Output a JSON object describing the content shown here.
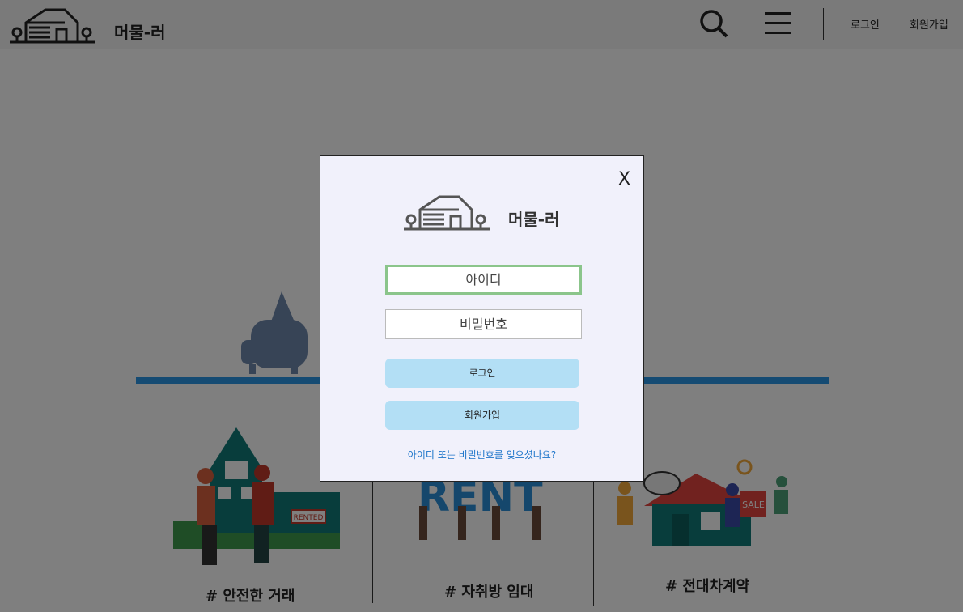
{
  "header": {
    "brand": "머물-러",
    "login_label": "로그인",
    "signup_label": "회원가입"
  },
  "main": {
    "captions": [
      "# 안전한 거래",
      "# 자취방 임대",
      "# 전대차계약"
    ],
    "rent_text": "RENT",
    "rented_sign": "RENTED",
    "sale_sign": "SALE"
  },
  "modal": {
    "close_label": "X",
    "brand": "머물-러",
    "id_placeholder": "아이디",
    "password_placeholder": "비밀번호",
    "login_button": "로그인",
    "signup_button": "회원가입",
    "forgot_link": "아이디 또는 비밀번호를 잊으셨나요?"
  },
  "colors": {
    "accent": "#2b97e6",
    "button": "#b3dff5",
    "focus_border": "#8bc58b",
    "link": "#1a73c9",
    "modal_bg": "#f1f1fb"
  }
}
